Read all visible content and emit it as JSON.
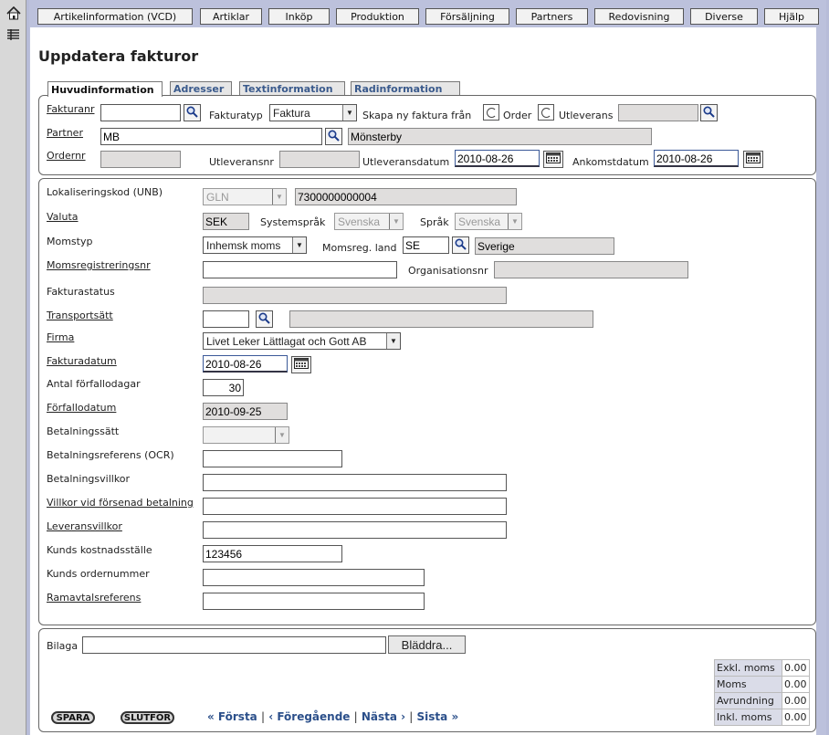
{
  "nav": [
    "Artikelinformation (VCD)",
    "Artiklar",
    "Inköp",
    "Produktion",
    "Försäljning",
    "Partners",
    "Redovisning",
    "Diverse",
    "Hjälp"
  ],
  "page_title": "Uppdatera fakturor",
  "tabs": [
    "Huvudinformation",
    "Adresser",
    "Textinformation",
    "Radinformation"
  ],
  "header": {
    "fakturanr_label": "Fakturanr",
    "fakturanr_value": "",
    "fakturatyp_label": "Fakturatyp",
    "fakturatyp_value": "Faktura",
    "skapa_label": "Skapa ny faktura från",
    "order_label": "Order",
    "utleverans_label": "Utleverans",
    "partner_label": "Partner",
    "partner_value": "MB",
    "partner_name": "Mönsterby",
    "ordernr_label": "Ordernr",
    "utleveransnr_label": "Utleveransnr",
    "utleveransdatum_label": "Utleveransdatum",
    "utleveransdatum_value": "2010-08-26",
    "ankomstdatum_label": "Ankomstdatum",
    "ankomstdatum_value": "2010-08-26"
  },
  "details": {
    "lokal_label": "Lokaliseringskod (UNB)",
    "lokal_type": "GLN",
    "lokal_value": "7300000000004",
    "valuta_label": "Valuta",
    "valuta_value": "SEK",
    "systemsprak_label": "Systemspråk",
    "systemsprak_value": "Svenska",
    "sprak_label": "Språk",
    "sprak_value": "Svenska",
    "momstyp_label": "Momstyp",
    "momstyp_value": "Inhemsk moms",
    "momsland_label": "Momsreg. land",
    "momsland_value": "SE",
    "momsland_name": "Sverige",
    "momsregnr_label": "Momsregistreringsnr",
    "orgnr_label": "Organisationsnr",
    "fakturastatus_label": "Fakturastatus",
    "transport_label": "Transportsätt",
    "firma_label": "Firma",
    "firma_value": "Livet Leker Lättlagat och Gott AB",
    "fakturadatum_label": "Fakturadatum",
    "fakturadatum_value": "2010-08-26",
    "antal_label": "Antal förfallodagar",
    "antal_value": "30",
    "forfallodatum_label": "Förfallodatum",
    "forfallodatum_value": "2010-09-25",
    "betalningssatt_label": "Betalningssätt",
    "ocr_label": "Betalningsreferens (OCR)",
    "villkor_label": "Betalningsvillkor",
    "forsenad_label": "Villkor vid försenad betalning",
    "leverans_label": "Leveransvillkor",
    "kostnad_label": "Kunds kostnadsställe",
    "kostnad_value": "123456",
    "ordernummer_label": "Kunds ordernummer",
    "ramavtal_label": "Ramavtalsreferens"
  },
  "bottom": {
    "bilaga_label": "Bilaga",
    "browse_label": "Bläddra...",
    "spara": "SPARA",
    "slutfor": "SLUTFÖR",
    "first": "« Första",
    "prev": "‹ Föregående",
    "next": "Nästa ›",
    "last": "Sista »",
    "totals": [
      {
        "label": "Exkl. moms",
        "value": "0.00"
      },
      {
        "label": "Moms",
        "value": "0.00"
      },
      {
        "label": "Avrundning",
        "value": "0.00"
      },
      {
        "label": "Inkl. moms",
        "value": "0.00"
      }
    ]
  },
  "icons": [
    "home-icon",
    "menu-icon",
    "search-icon",
    "calendar-icon"
  ]
}
